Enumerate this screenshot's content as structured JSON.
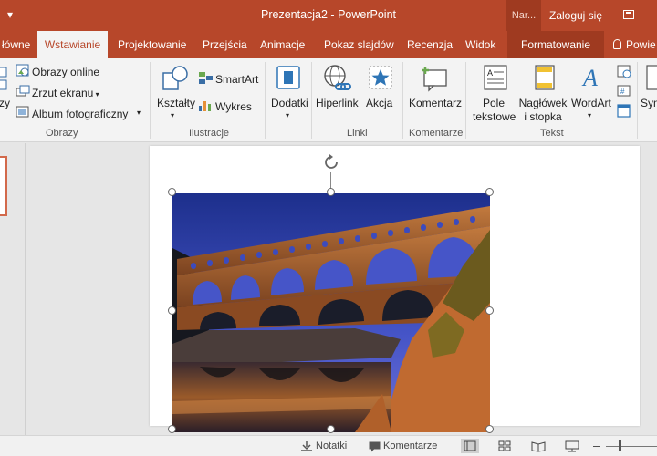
{
  "titlebar": {
    "qat_glyph": "▾",
    "title": "Prezentacja2 - PowerPoint",
    "context_tools": "Nar...",
    "sign_in": "Zaloguj się"
  },
  "tabs": [
    {
      "label": "łówne"
    },
    {
      "label": "Wstawianie",
      "active": true
    },
    {
      "label": "Projektowanie"
    },
    {
      "label": "Przejścia"
    },
    {
      "label": "Animacje"
    },
    {
      "label": "Pokaz slajdów"
    },
    {
      "label": "Recenzja"
    },
    {
      "label": "Widok"
    },
    {
      "label": "Formatowanie"
    }
  ],
  "tell_me": "Powie",
  "ribbon": {
    "images_group": {
      "cut_label": "zy",
      "online": "Obrazy online",
      "screenshot": "Zrzut ekranu",
      "album": "Album fotograficzny",
      "label": "Obrazy"
    },
    "illustrations_group": {
      "shapes": "Kształty",
      "smartart": "SmartArt",
      "chart": "Wykres",
      "label": "Ilustracje"
    },
    "addins_group": {
      "addins": "Dodatki"
    },
    "links_group": {
      "hyperlink": "Hiperlink",
      "action": "Akcja",
      "label": "Linki"
    },
    "comments_group": {
      "comment": "Komentarz",
      "label": "Komentarze"
    },
    "text_group": {
      "textbox_line1": "Pole",
      "textbox_line2": "tekstowe",
      "header_line1": "Nagłówek",
      "header_line2": "i stopka",
      "wordart": "WordArt",
      "label": "Tekst"
    },
    "symbols_group": {
      "symbols": "Sym"
    }
  },
  "status": {
    "notes": "Notatki",
    "comments": "Komentarze"
  },
  "colors": {
    "accent": "#b7472a",
    "accent_dark": "#9f3a20",
    "ribbon_bg": "#f3f3f3",
    "workspace_bg": "#e6e6e6"
  }
}
